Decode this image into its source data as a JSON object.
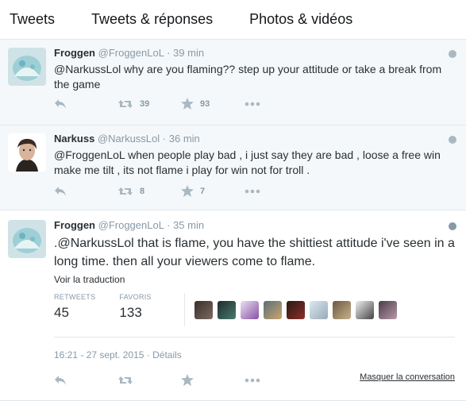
{
  "tabs": [
    "Tweets",
    "Tweets & réponses",
    "Photos & vidéos"
  ],
  "tweets": [
    {
      "name": "Froggen",
      "handle": "@FroggenLoL",
      "sep": "·",
      "time": "39 min",
      "text": "@NarkussLol why are you flaming?? step up your attitude or take a break from the game",
      "retweets": "39",
      "favorites": "93"
    },
    {
      "name": "Narkuss",
      "handle": "@NarkussLol",
      "sep": "·",
      "time": "36 min",
      "text": "@FroggenLoL when people play bad , i just say they are bad , loose a free win make me tilt , its not flame i play for win not for troll .",
      "retweets": "8",
      "favorites": "7"
    },
    {
      "name": "Froggen",
      "handle": "@FroggenLoL",
      "sep": "·",
      "time": "35 min",
      "text": ".@NarkussLol that is flame, you have the shittiest attitude i've seen in a long time. then all your viewers come to flame.",
      "translate": "Voir la traduction",
      "retweets_label": "RETWEETS",
      "retweets": "45",
      "favorites_label": "FAVORIS",
      "favorites": "133",
      "date": "16:21 - 27 sept. 2015",
      "details": "Détails",
      "hide": "Masquer la conversation"
    }
  ],
  "colors": {
    "icon": "#aab8c2",
    "muted": "#8899a6",
    "border": "#e1e8ed"
  },
  "icons": [
    "reply-icon",
    "retweet-icon",
    "favorite-icon",
    "more-icon",
    "globe-icon"
  ]
}
